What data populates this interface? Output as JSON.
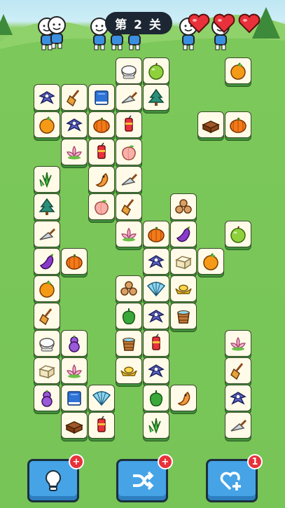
{
  "level": {
    "label": "第 2 关"
  },
  "lives": {
    "count": 3,
    "heart_color": "#e8313a"
  },
  "tiles": [
    {
      "col": 165,
      "row": 82,
      "icon": "rice"
    },
    {
      "col": 204,
      "row": 82,
      "icon": "apple"
    },
    {
      "col": 321,
      "row": 82,
      "icon": "orange"
    },
    {
      "col": 48,
      "row": 120,
      "icon": "pigeon"
    },
    {
      "col": 87,
      "row": 120,
      "icon": "broom"
    },
    {
      "col": 126,
      "row": 120,
      "icon": "book"
    },
    {
      "col": 165,
      "row": 120,
      "icon": "trowel"
    },
    {
      "col": 204,
      "row": 120,
      "icon": "tree"
    },
    {
      "col": 48,
      "row": 159,
      "icon": "orange"
    },
    {
      "col": 87,
      "row": 159,
      "icon": "pigeon"
    },
    {
      "col": 126,
      "row": 159,
      "icon": "pumpkin"
    },
    {
      "col": 165,
      "row": 159,
      "icon": "firecracker"
    },
    {
      "col": 282,
      "row": 159,
      "icon": "bricks"
    },
    {
      "col": 321,
      "row": 159,
      "icon": "pumpkin"
    },
    {
      "col": 87,
      "row": 198,
      "icon": "lotus"
    },
    {
      "col": 126,
      "row": 198,
      "icon": "firecracker"
    },
    {
      "col": 165,
      "row": 198,
      "icon": "peach"
    },
    {
      "col": 48,
      "row": 237,
      "icon": "grass"
    },
    {
      "col": 126,
      "row": 237,
      "icon": "shrimp"
    },
    {
      "col": 165,
      "row": 237,
      "icon": "trowel"
    },
    {
      "col": 48,
      "row": 276,
      "icon": "tree"
    },
    {
      "col": 126,
      "row": 276,
      "icon": "peach"
    },
    {
      "col": 165,
      "row": 276,
      "icon": "broom"
    },
    {
      "col": 243,
      "row": 276,
      "icon": "logs"
    },
    {
      "col": 48,
      "row": 315,
      "icon": "trowel"
    },
    {
      "col": 165,
      "row": 315,
      "icon": "lotus"
    },
    {
      "col": 204,
      "row": 315,
      "icon": "pumpkin"
    },
    {
      "col": 243,
      "row": 315,
      "icon": "eggplant"
    },
    {
      "col": 321,
      "row": 315,
      "icon": "apple"
    },
    {
      "col": 48,
      "row": 354,
      "icon": "eggplant"
    },
    {
      "col": 87,
      "row": 354,
      "icon": "pumpkin"
    },
    {
      "col": 204,
      "row": 354,
      "icon": "pigeon"
    },
    {
      "col": 243,
      "row": 354,
      "icon": "tofu"
    },
    {
      "col": 282,
      "row": 354,
      "icon": "orange"
    },
    {
      "col": 48,
      "row": 393,
      "icon": "orange"
    },
    {
      "col": 165,
      "row": 393,
      "icon": "logs"
    },
    {
      "col": 204,
      "row": 393,
      "icon": "fan"
    },
    {
      "col": 243,
      "row": 393,
      "icon": "ingot"
    },
    {
      "col": 48,
      "row": 432,
      "icon": "broom"
    },
    {
      "col": 165,
      "row": 432,
      "icon": "pepper"
    },
    {
      "col": 204,
      "row": 432,
      "icon": "pigeon"
    },
    {
      "col": 243,
      "row": 432,
      "icon": "bucket"
    },
    {
      "col": 48,
      "row": 471,
      "icon": "rice"
    },
    {
      "col": 87,
      "row": 471,
      "icon": "gourd"
    },
    {
      "col": 165,
      "row": 471,
      "icon": "bucket"
    },
    {
      "col": 204,
      "row": 471,
      "icon": "firecracker"
    },
    {
      "col": 321,
      "row": 471,
      "icon": "lotus"
    },
    {
      "col": 48,
      "row": 510,
      "icon": "tofu"
    },
    {
      "col": 87,
      "row": 510,
      "icon": "lotus"
    },
    {
      "col": 165,
      "row": 510,
      "icon": "ingot"
    },
    {
      "col": 204,
      "row": 510,
      "icon": "pigeon"
    },
    {
      "col": 321,
      "row": 510,
      "icon": "broom"
    },
    {
      "col": 48,
      "row": 549,
      "icon": "gourd"
    },
    {
      "col": 87,
      "row": 549,
      "icon": "book"
    },
    {
      "col": 126,
      "row": 549,
      "icon": "fan"
    },
    {
      "col": 204,
      "row": 549,
      "icon": "pepper"
    },
    {
      "col": 243,
      "row": 549,
      "icon": "shrimp"
    },
    {
      "col": 321,
      "row": 549,
      "icon": "pigeon"
    },
    {
      "col": 87,
      "row": 588,
      "icon": "bricks"
    },
    {
      "col": 126,
      "row": 588,
      "icon": "firecracker"
    },
    {
      "col": 204,
      "row": 588,
      "icon": "grass"
    },
    {
      "col": 321,
      "row": 588,
      "icon": "trowel"
    }
  ],
  "buttons": [
    {
      "name": "hint-button",
      "icon": "lightbulb-icon",
      "badge": "+"
    },
    {
      "name": "shuffle-button",
      "icon": "shuffle-icon",
      "badge": "+"
    },
    {
      "name": "add-life-button",
      "icon": "heart-plus-icon",
      "badge": "1"
    }
  ]
}
